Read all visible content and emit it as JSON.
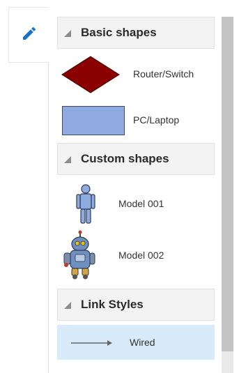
{
  "tabs": {
    "edit_icon": "pencil-icon"
  },
  "palette": {
    "basic": {
      "title": "Basic shapes",
      "items": [
        {
          "label": "Router/Switch",
          "icon": "diamond-shape-icon",
          "color": "#8b0000"
        },
        {
          "label": "PC/Laptop",
          "icon": "rectangle-shape-icon",
          "color": "#8eaadf"
        }
      ]
    },
    "custom": {
      "title": "Custom shapes",
      "items": [
        {
          "label": "Model 001",
          "icon": "person-figure-icon"
        },
        {
          "label": "Model 002",
          "icon": "robot-icon"
        }
      ]
    },
    "links": {
      "title": "Link Styles",
      "items": [
        {
          "label": "Wired",
          "icon": "arrow-line-icon",
          "selected": true
        }
      ]
    }
  },
  "colors": {
    "accent": "#1a73c9",
    "selected_bg": "#d7ebfb"
  }
}
